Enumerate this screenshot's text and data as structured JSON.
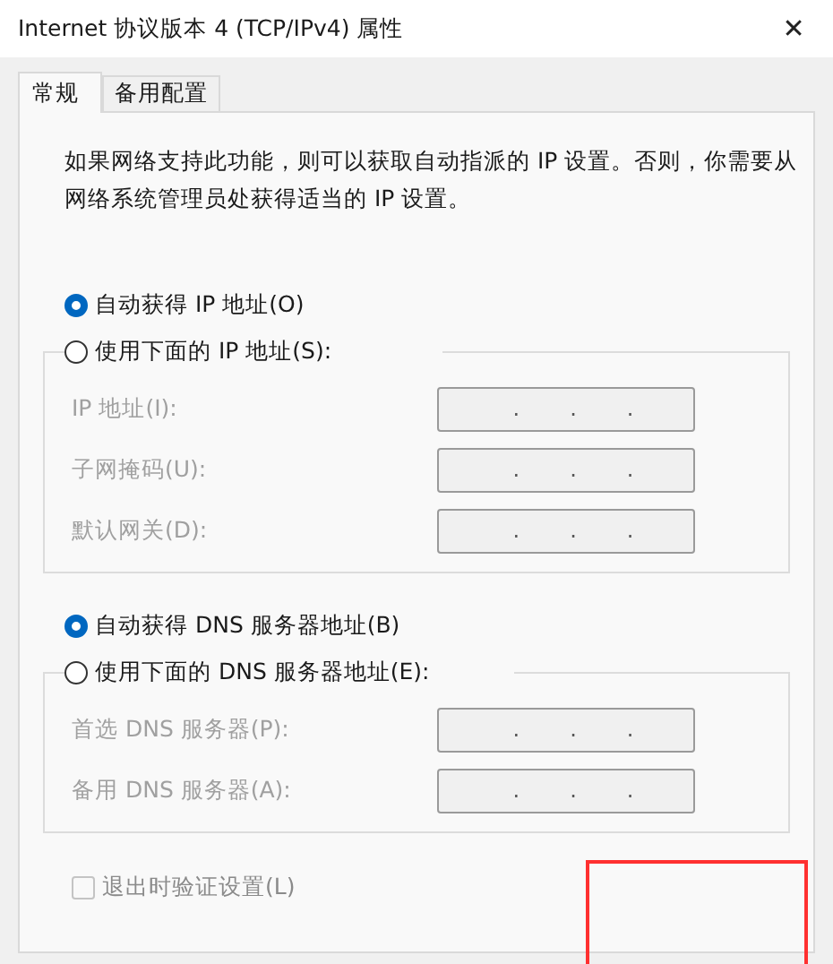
{
  "window": {
    "title": "Internet 协议版本 4 (TCP/IPv4) 属性",
    "close": "✕"
  },
  "tabs": [
    {
      "label": "常规",
      "selected": true
    },
    {
      "label": "备用配置",
      "selected": false
    }
  ],
  "description": "如果网络支持此功能，则可以获取自动指派的 IP 设置。否则，你需要从网络系统管理员处获得适当的 IP 设置。",
  "sections": [
    {
      "auto_option": {
        "label": "自动获得 IP 地址(O)",
        "selected": true
      },
      "manual_option": {
        "label": "使用下面的 IP 地址(S):",
        "selected": false
      },
      "fields": [
        {
          "label": "IP 地址(I):",
          "disabled": true,
          "separators": [
            ".",
            ".",
            "."
          ]
        },
        {
          "label": "子网掩码(U):",
          "disabled": true,
          "separators": [
            ".",
            ".",
            "."
          ]
        },
        {
          "label": "默认网关(D):",
          "disabled": true,
          "separators": [
            ".",
            ".",
            "."
          ]
        }
      ]
    },
    {
      "auto_option": {
        "label": "自动获得 DNS 服务器地址(B)",
        "selected": true
      },
      "manual_option": {
        "label": "使用下面的 DNS 服务器地址(E):",
        "selected": false
      },
      "fields": [
        {
          "label": "首选 DNS 服务器(P):",
          "disabled": true,
          "separators": [
            ".",
            ".",
            "."
          ]
        },
        {
          "label": "备用 DNS 服务器(A):",
          "disabled": true,
          "separators": [
            ".",
            ".",
            "."
          ]
        }
      ]
    }
  ],
  "validate_checkbox": {
    "label": "退出时验证设置(L)",
    "checked": false,
    "disabled": true
  }
}
